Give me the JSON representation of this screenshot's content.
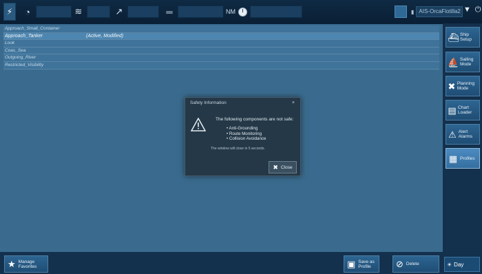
{
  "profiles": [
    {
      "name": "Approach_Small_Container",
      "status": ""
    },
    {
      "name": "Approach_Tanker",
      "status": "(Active, Modified)"
    },
    {
      "name": "Look",
      "status": ""
    },
    {
      "name": "Coas_Sea",
      "status": ""
    },
    {
      "name": "Outgoing_River",
      "status": ""
    },
    {
      "name": "Restricted_Visibility",
      "status": ""
    }
  ],
  "topbar": {
    "nm_label": "NM",
    "vessel_name": "AIS-OrcaFlotilla2"
  },
  "sidebar": {
    "ship_setup": "Ship Setup",
    "sailing_mode": "Sailing Mode",
    "planning_mode": "Planning Mode",
    "chart_loader": "Chart Loader",
    "alarms": "Alert Alarms",
    "profiles": "Profiles"
  },
  "bottom": {
    "manage_favorites": "Manage Favorites",
    "save_as_profile": "Save as Profile",
    "delete": "Delete",
    "zoom": "Day"
  },
  "dialog": {
    "title": "Safety Information",
    "close_x": "×",
    "heading": "The following components are not safe:",
    "items": [
      "Anti-Grounding",
      "Route Monitoring",
      "Collision Avoidance"
    ],
    "note": "The window will close in 5 seconds.",
    "close_label": "Close"
  },
  "colors": {
    "background": "#3a6b8e",
    "topbar": "#0f2a44",
    "dialog": "#243847",
    "active_sidebar": "#4c8bc1"
  }
}
